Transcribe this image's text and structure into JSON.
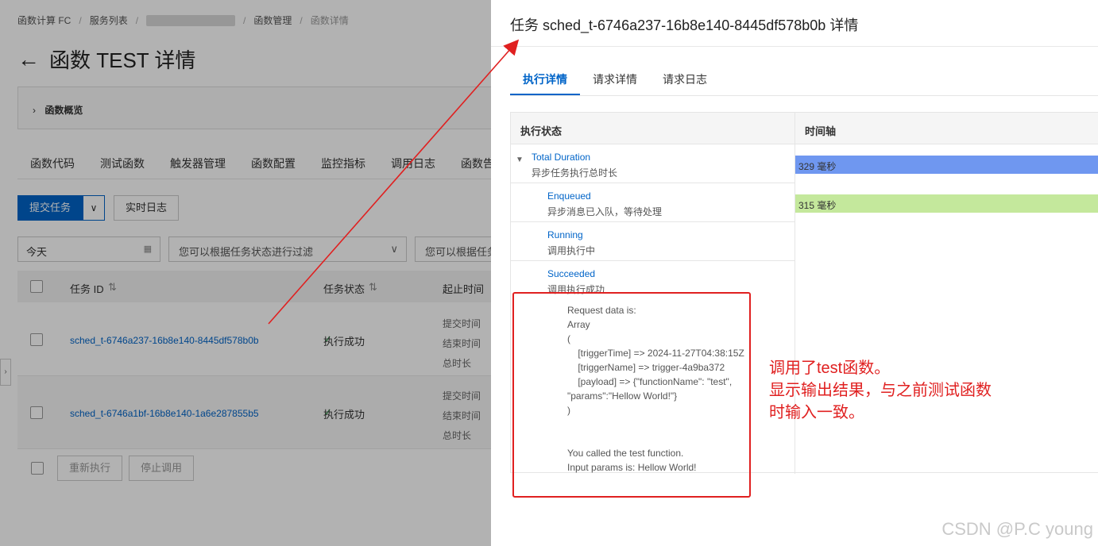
{
  "background_page": {
    "breadcrumb": [
      "函数计算 FC",
      "服务列表",
      "函数管理",
      "函数详情"
    ],
    "title": "函数 TEST 详情",
    "overview_label": "函数概览",
    "tabs": [
      "函数代码",
      "测试函数",
      "触发器管理",
      "函数配置",
      "监控指标",
      "调用日志",
      "函数告"
    ],
    "submit_task_label": "提交任务",
    "realtime_log_label": "实时日志",
    "date_filter_value": "今天",
    "status_filter_placeholder": "您可以根据任务状态进行过滤",
    "status_filter_placeholder_2": "您可以根据任务",
    "table_headers": [
      "任务 ID",
      "任务状态",
      "起止时间"
    ],
    "sort_glyph": "⇅",
    "rows": [
      {
        "task_id": "sched_t-6746a237-16b8e140-8445df578b0b",
        "status": "执行成功",
        "time_labels": [
          "提交时间",
          "结束时间",
          "总时长"
        ]
      },
      {
        "task_id": "sched_t-6746a1bf-16b8e140-1a6e287855b5",
        "status": "执行成功",
        "time_labels": [
          "提交时间",
          "结束时间",
          "总时长"
        ]
      }
    ],
    "rerun_label": "重新执行",
    "stop_label": "停止调用"
  },
  "drawer": {
    "title": "任务 sched_t-6746a237-16b8e140-8445df578b0b 详情",
    "tabs": [
      "执行详情",
      "请求详情",
      "请求日志"
    ],
    "active_tab": "执行详情",
    "columns": [
      "执行状态",
      "时间轴"
    ],
    "states": [
      {
        "name": "Total Duration",
        "desc": "异步任务执行总时长"
      },
      {
        "name": "Enqueued",
        "desc": "异步消息已入队，等待处理"
      },
      {
        "name": "Running",
        "desc": "调用执行中"
      },
      {
        "name": "Succeeded",
        "desc": "调用执行成功"
      }
    ],
    "timeline": [
      {
        "label": "329 毫秒",
        "value_ms": 329,
        "color": "#6f97f0"
      },
      {
        "label": "315 毫秒",
        "value_ms": 315,
        "color": "#c4e89c"
      }
    ],
    "log_text": "Request data is:\nArray\n(\n    [triggerTime] => 2024-11-27T04:38:15Z\n    [triggerName] => trigger-4a9ba372\n    [payload] => {\"functionName\": \"test\",\n\"params\":\"Hellow World!\"}\n)\n\n\nYou called the test function.\nInput params is: Hellow World!"
  },
  "annotation": {
    "lines": [
      "调用了test函数。",
      "显示输出结果，与之前测试函数",
      "时输入一致。"
    ],
    "color": "#e02020"
  },
  "watermark": "CSDN @P.C young",
  "accent_color": "#0064c8"
}
